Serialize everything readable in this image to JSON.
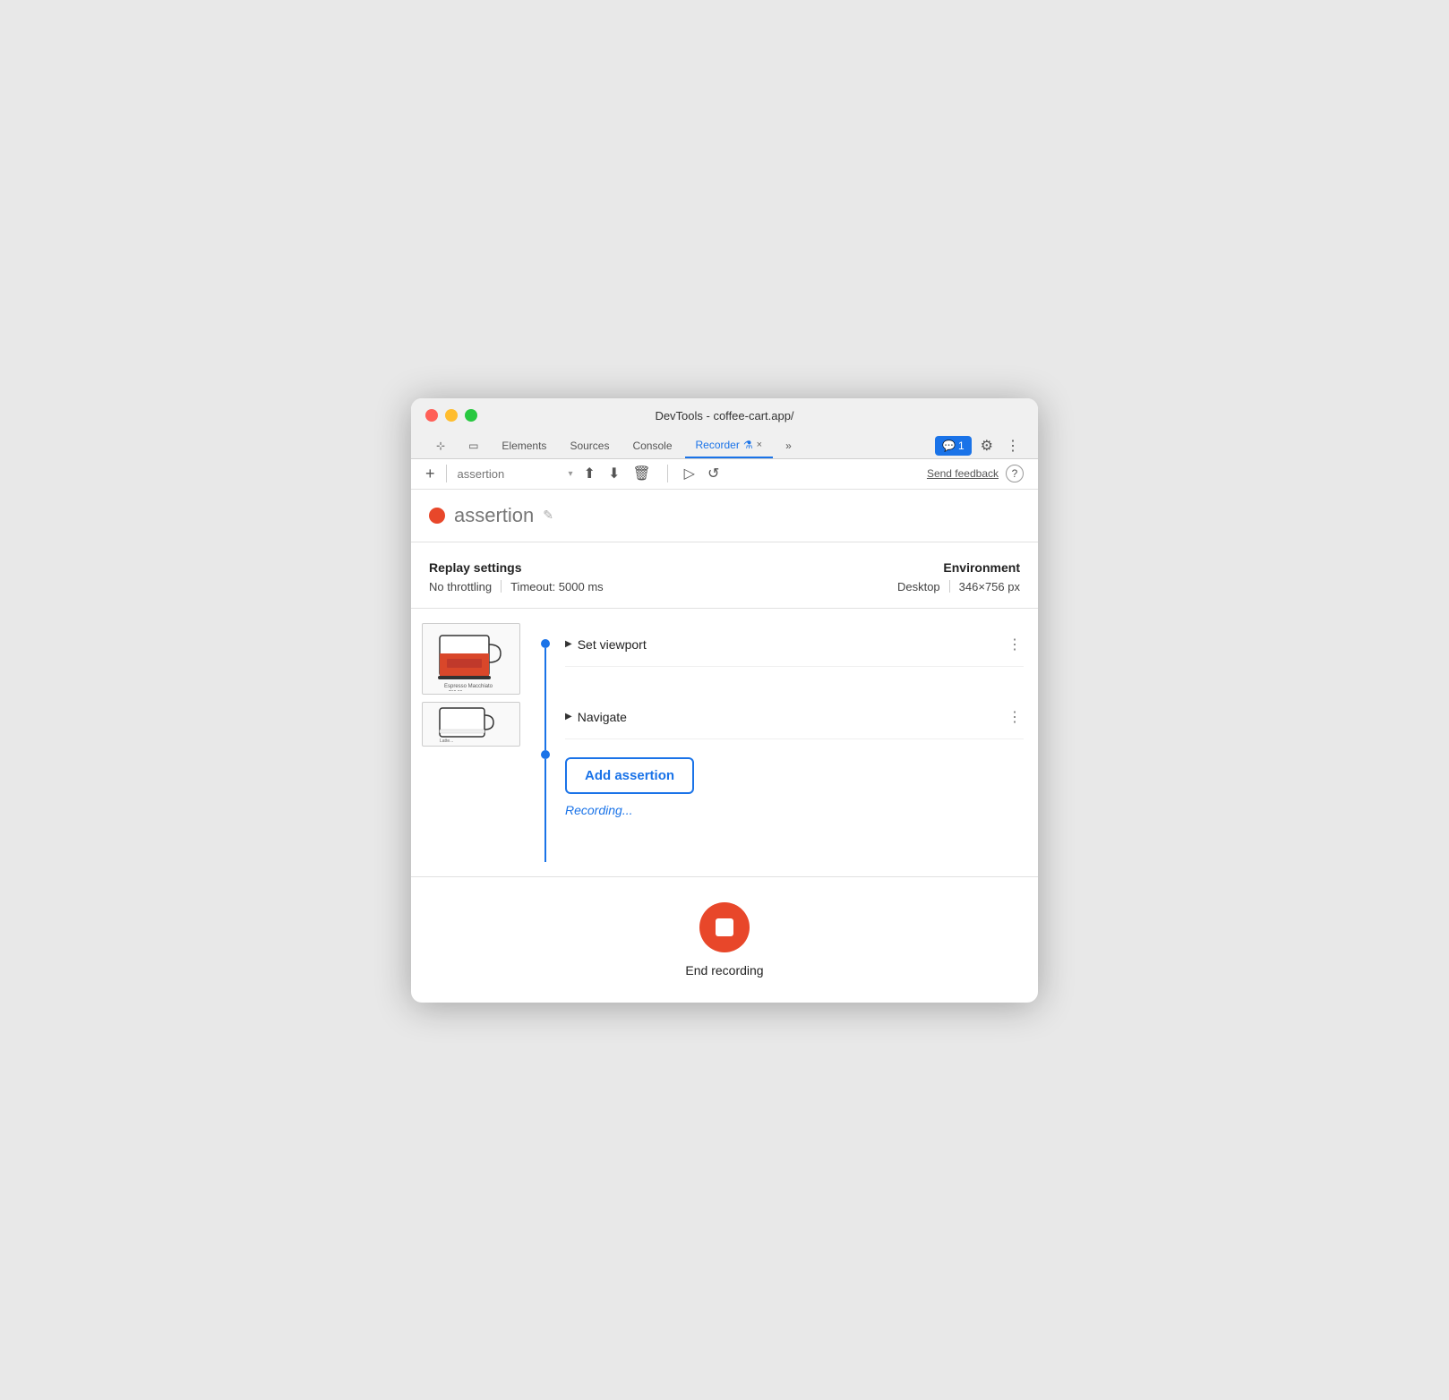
{
  "window": {
    "title": "DevTools - coffee-cart.app/"
  },
  "tabs": [
    {
      "id": "elements",
      "label": "Elements",
      "active": false
    },
    {
      "id": "sources",
      "label": "Sources",
      "active": false
    },
    {
      "id": "console",
      "label": "Console",
      "active": false
    },
    {
      "id": "recorder",
      "label": "Recorder",
      "active": true
    },
    {
      "id": "more",
      "label": "»",
      "active": false
    }
  ],
  "header": {
    "badge_count": "1",
    "badge_label": "1"
  },
  "toolbar": {
    "add_label": "+",
    "input_placeholder": "assertion",
    "send_feedback": "Send feedback",
    "help_label": "?"
  },
  "recording": {
    "title": "assertion",
    "status_dot_color": "#e8472a"
  },
  "settings": {
    "replay_title": "Replay settings",
    "throttling": "No throttling",
    "timeout": "Timeout: 5000 ms",
    "environment_title": "Environment",
    "device": "Desktop",
    "resolution": "346×756 px"
  },
  "steps": [
    {
      "label": "Set viewport",
      "has_dot": true
    },
    {
      "label": "Navigate",
      "has_dot": true
    }
  ],
  "add_assertion": {
    "button_label": "Add assertion",
    "status_label": "Recording..."
  },
  "end_recording": {
    "label": "End recording"
  },
  "icons": {
    "edit": "✎",
    "chevron_down": "▾",
    "export": "↑",
    "import": "↓",
    "delete": "🗑",
    "play": "▷",
    "replay": "↺",
    "step_arrow": "▶",
    "more_vert": "⋮"
  }
}
